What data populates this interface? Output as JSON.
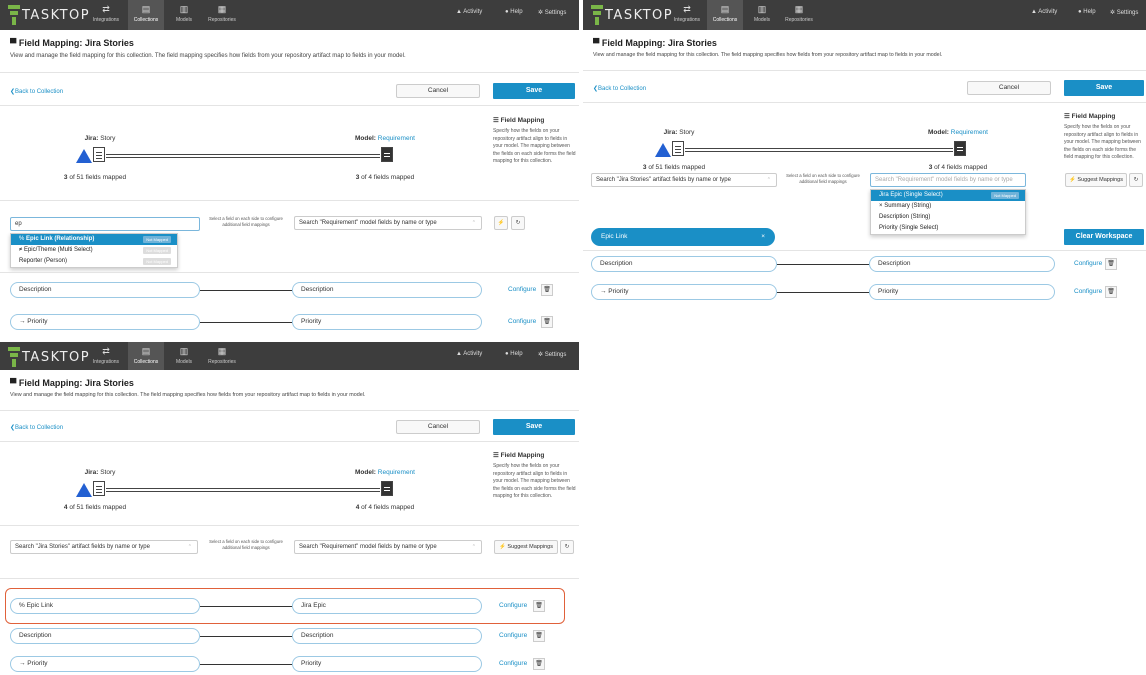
{
  "nav": {
    "brand": "TASKTOP",
    "tabs": [
      {
        "label": "Integrations",
        "icon": "⇄"
      },
      {
        "label": "Collections",
        "icon": "▤"
      },
      {
        "label": "Models",
        "icon": "▥"
      },
      {
        "label": "Repositories",
        "icon": "▦"
      }
    ],
    "activity": "Activity",
    "help": "Help",
    "settings": "Settings"
  },
  "page": {
    "title": "Field Mapping: Jira Stories",
    "subtitle": "View and manage the field mapping for this collection. The field mapping specifies how fields from your repository artifact map to fields in your model.",
    "back": "Back to Collection",
    "cancel": "Cancel",
    "save": "Save"
  },
  "sidebar": {
    "title": "Field Mapping",
    "description": "Specify how the fields on your repository artifact align to fields in your model. The mapping between the fields on each side forms the field mapping for this collection."
  },
  "summary": {
    "jira_prefix": "Jira:",
    "jira_type": "Story",
    "model_prefix": "Model:",
    "model_type": "Requirement",
    "fields_mapped_suffix": "fields mapped",
    "jira_total": "of 51",
    "model_total": "of 4"
  },
  "panels": [
    {
      "jira_mapped": "3",
      "model_mapped": "3",
      "search_value": "ep",
      "hint": "Select a field on each side to configure additional field mappings",
      "model_search": "Search \"Requirement\" model fields by name or type",
      "dropdown": [
        {
          "icon": "%",
          "label": "Epic Link (Relationship)",
          "badge": "Not Mapped"
        },
        {
          "icon": "≠",
          "label": "Epic/Theme (Multi Select)",
          "badge": "Not Mapped"
        },
        {
          "icon": "",
          "label": "Reporter (Person)",
          "badge": "Not Mapped"
        }
      ],
      "rows": [
        {
          "left": "Description",
          "right": "Description",
          "configure": "Configure"
        },
        {
          "left": "→ Priority",
          "right": "Priority",
          "configure": "Configure"
        }
      ]
    },
    {
      "jira_mapped": "3",
      "model_mapped": "3",
      "jira_search": "Search \"Jira Stories\" artifact fields by name or type",
      "hint": "Select a field on each side to configure additional field mappings",
      "model_search_placeholder": "Search \"Requirement\" model fields by name or type",
      "suggest": "Suggest Mappings",
      "workspace_pill": "Epic Link",
      "clear_workspace": "Clear Workspace",
      "dropdown": [
        {
          "icon": "",
          "label": "Jira Epic (Single Select)",
          "badge": "Not Mapped"
        },
        {
          "icon": "×",
          "label": "Summary (String)",
          "badge": ""
        },
        {
          "icon": "",
          "label": "Description (String)",
          "badge": ""
        },
        {
          "icon": "",
          "label": "Priority (Single Select)",
          "badge": ""
        }
      ],
      "rows": [
        {
          "left": "Description",
          "right": "Description",
          "configure": "Configure"
        },
        {
          "left": "→ Priority",
          "right": "Priority",
          "configure": "Configure"
        }
      ]
    },
    {
      "jira_mapped": "4",
      "model_mapped": "4",
      "jira_search": "Search \"Jira Stories\" artifact fields by name or type",
      "hint": "Select a field on each side to configure additional field mappings",
      "model_search": "Search \"Requirement\" model fields by name or type",
      "suggest": "Suggest Mappings",
      "rows": [
        {
          "left": "% Epic Link",
          "right": "Jira Epic",
          "configure": "Configure"
        },
        {
          "left": "Description",
          "right": "Description",
          "configure": "Configure"
        },
        {
          "left": "→ Priority",
          "right": "Priority",
          "configure": "Configure"
        }
      ]
    }
  ]
}
